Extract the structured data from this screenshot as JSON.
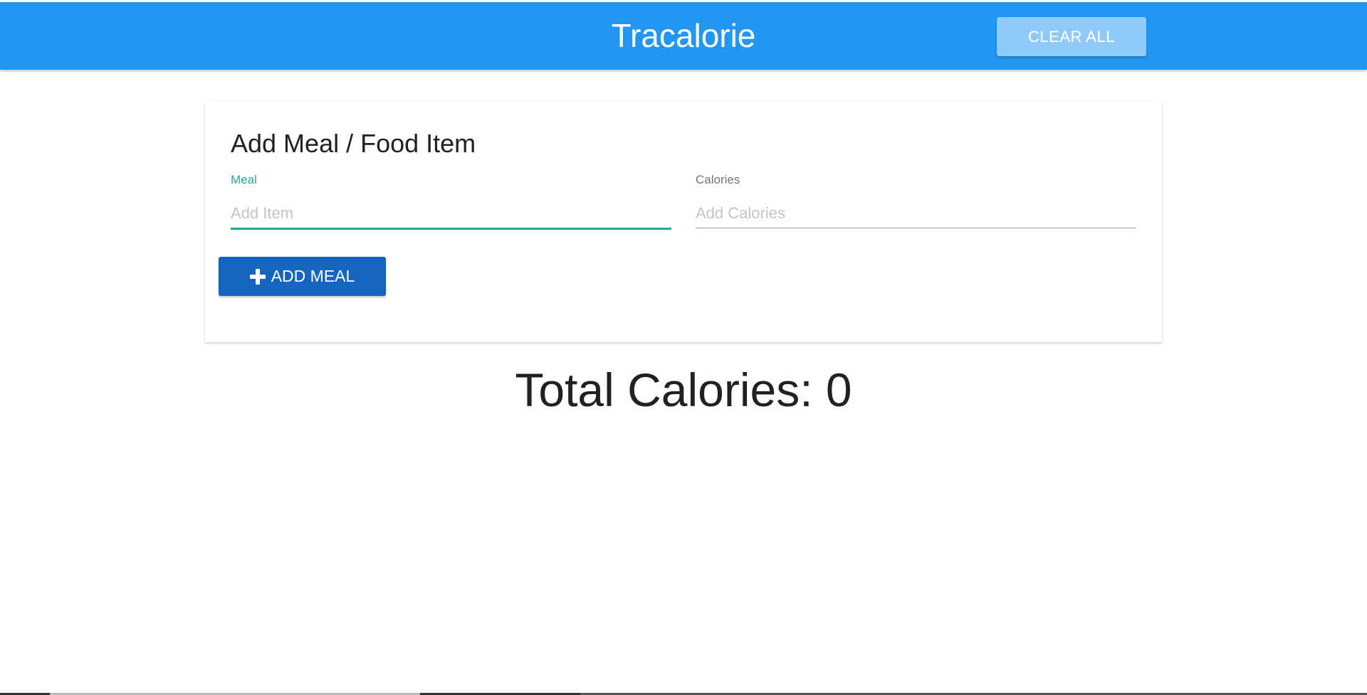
{
  "navbar": {
    "brand": "Tracalorie",
    "clear_all_label": "CLEAR ALL",
    "color": "#2196f3"
  },
  "card": {
    "title": "Add Meal / Food Item",
    "meal_field": {
      "label": "Meal",
      "placeholder": "Add Item",
      "value": ""
    },
    "calories_field": {
      "label": "Calories",
      "placeholder": "Add Calories",
      "value": ""
    },
    "add_meal_label": "ADD MEAL"
  },
  "total": {
    "text": "Total Calories: 0"
  },
  "icons": [
    "plus-icon"
  ],
  "colors": {
    "accent": "#26a69a",
    "add_button": "#1565c0",
    "clear_button": "#90caf9"
  }
}
